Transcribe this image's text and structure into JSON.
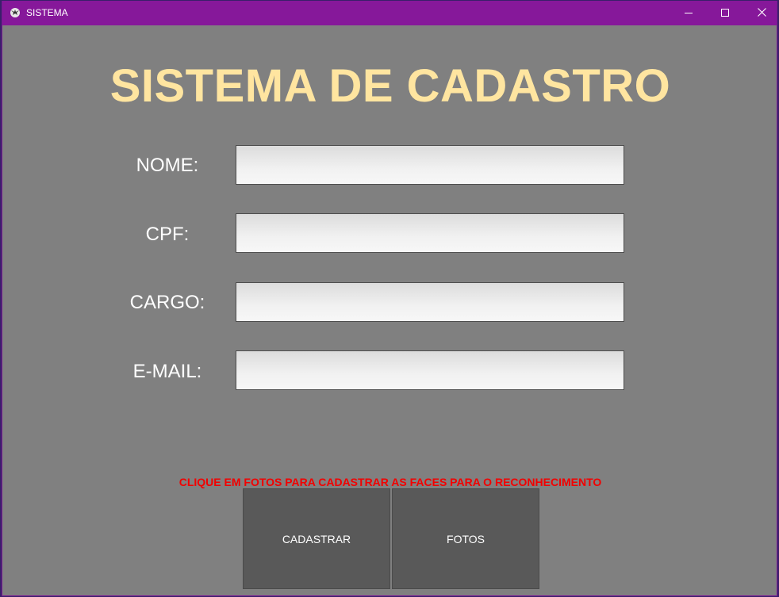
{
  "window": {
    "title": "SISTEMA",
    "titlebar_color": "#86189a",
    "background_color": "#808080"
  },
  "heading": "SISTEMA DE CADASTRO",
  "heading_color": "#ffe5a0",
  "form": {
    "fields": [
      {
        "label": "NOME:",
        "value": "",
        "placeholder": ""
      },
      {
        "label": "CPF:",
        "value": "",
        "placeholder": ""
      },
      {
        "label": "CARGO:",
        "value": "",
        "placeholder": ""
      },
      {
        "label": "E-MAIL:",
        "value": "",
        "placeholder": ""
      }
    ]
  },
  "hint": "CLIQUE EM FOTOS PARA CADASTRAR AS FACES PARA O RECONHECIMENTO",
  "hint_color": "#f20000",
  "buttons": {
    "cadastrar": "CADASTRAR",
    "fotos": "FOTOS"
  },
  "icons": {
    "app": "kivy-app-icon",
    "minimize": "minimize-icon",
    "maximize": "maximize-icon",
    "close": "close-icon"
  }
}
